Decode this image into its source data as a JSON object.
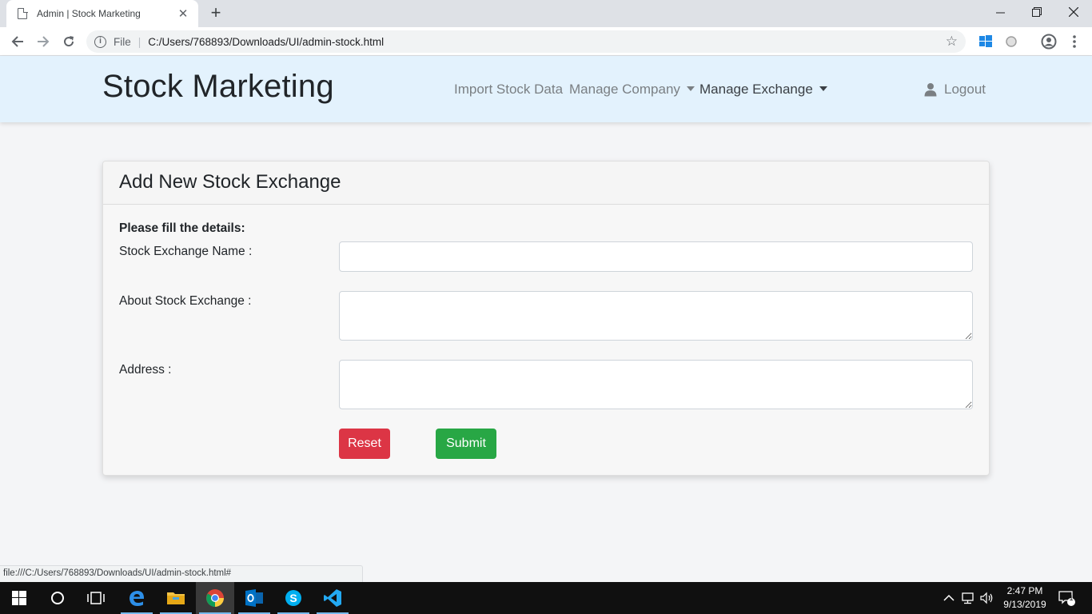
{
  "browser": {
    "tab_title": "Admin | Stock Marketing",
    "tab_close": "✕",
    "new_tab": "+",
    "address_scheme": "File",
    "address_url": "C:/Users/768893/Downloads/UI/admin-stock.html",
    "status_url": "file:///C:/Users/768893/Downloads/UI/admin-stock.html#"
  },
  "navbar": {
    "brand": "Stock Marketing",
    "links": [
      {
        "label": "Import Stock Data"
      },
      {
        "label": "Manage Company"
      },
      {
        "label": "Manage Exchange"
      }
    ],
    "logout": "Logout"
  },
  "card": {
    "title": "Add New Stock Exchange",
    "instruction": "Please fill the details:",
    "fields": [
      {
        "label": "Stock Exchange Name :",
        "value": ""
      },
      {
        "label": "About Stock Exchange :",
        "value": ""
      },
      {
        "label": "Address :",
        "value": ""
      }
    ],
    "reset_label": "Reset",
    "submit_label": "Submit"
  },
  "taskbar": {
    "time": "2:47 PM",
    "date": "9/13/2019",
    "notification_count": "1"
  },
  "colors": {
    "navbar_bg": "#e3f2fd",
    "reset": "#dc3545",
    "submit": "#28a745"
  }
}
